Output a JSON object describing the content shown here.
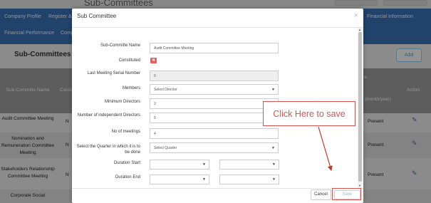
{
  "background": {
    "page_title": "Sub-Committees",
    "nav_items": [
      "Company Profile",
      "Register &",
      "Financial Information",
      "Financial Performance",
      "Comp"
    ],
    "section_title": "Sub-Committees",
    "add_button": "Add",
    "table_headers": [
      "Sub-Committe Name",
      "Consti",
      "e",
      "(month/year)",
      "Action"
    ],
    "rows": [
      {
        "name": "Audit Committee Meeting",
        "constituted": "N",
        "last": "Present"
      },
      {
        "name": "Nomination and Remuneration Committee Meeting",
        "constituted": "N",
        "last": "Present"
      },
      {
        "name": "Stakeholders Relationship Committee Meeting",
        "constituted": "N",
        "last": "Present"
      },
      {
        "name": "Corporate Social",
        "constituted": "",
        "last": ""
      }
    ],
    "action_icon": "pencil-icon"
  },
  "modal": {
    "title": "Sub Committee",
    "close_symbol": "×",
    "fields": {
      "name_label": "Sub-Committe Name",
      "name_value": "Audit Committee Meeting",
      "constituted_label": "Constituted",
      "constituted_value": "N",
      "serial_label": "Last Meeting Serial Number",
      "serial_value": "0",
      "members_label": "Members",
      "members_value": "Select Director",
      "min_label": "Minimum Directors",
      "min_value": "2",
      "indep_label": "Number of independent Directors",
      "indep_value": "0",
      "meetings_label": "No of meetings",
      "meetings_value": "4",
      "quarter_label": "Select the Quarter in which it is to be done",
      "quarter_value": "Select Quarter",
      "start_label": "Duration Start",
      "end_label": "Duration End"
    },
    "cancel_label": "Cancel",
    "save_label": "Save"
  },
  "annotation": {
    "callout_text": "Click Here to save"
  },
  "colors": {
    "nav_blue": "#3a72b8",
    "accent_red": "#d9534f",
    "badge_red": "#f15a5a",
    "save_blue": "#7cc6ea"
  }
}
